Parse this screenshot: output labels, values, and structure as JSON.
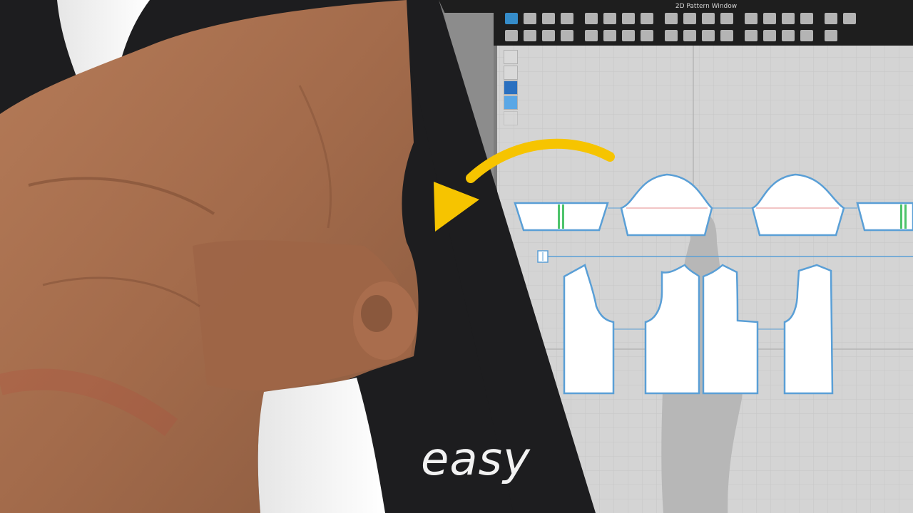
{
  "window": {
    "title": "2D Pattern Window"
  },
  "overlay": {
    "caption": "easy"
  },
  "colors": {
    "accent_arrow": "#f6c400",
    "pattern_outline": "#5a9fd6",
    "canvas": "#d4d4d4",
    "toolbar_bg": "#1e1e1e",
    "garment": "#a8704f",
    "background": "#1d1d1f"
  },
  "toolbar": {
    "row1_icons": [
      "edit-pattern-icon",
      "transform-pattern-icon",
      "edit-point-icon",
      "create-rectangle-icon",
      "create-polygon-icon",
      "create-circle-icon",
      "create-internal-shape-icon",
      "trace-icon",
      "cut-icon",
      "fold-icon",
      "seam-icon",
      "segment-sew-icon",
      "free-sew-icon",
      "text-icon",
      "text-size-icon",
      "measure-icon",
      "avatar-icon",
      "pin-icon"
    ],
    "row2_icons": [
      "fold-arrangement-icon",
      "tack-icon",
      "elastic-icon",
      "button-icon",
      "buttonhole-icon",
      "zipper-icon",
      "topstitch-icon",
      "grade-icon",
      "symmetry-icon",
      "baseline-icon",
      "internal-line-icon",
      "piping-icon",
      "puckering-icon",
      "style-line-icon",
      "shrinkage-icon",
      "layer-icon",
      "stack-icon"
    ]
  },
  "side_tools": [
    "select-icon",
    "move-icon",
    "info-icon",
    "texture-icon",
    "disabled-tool-icon"
  ]
}
